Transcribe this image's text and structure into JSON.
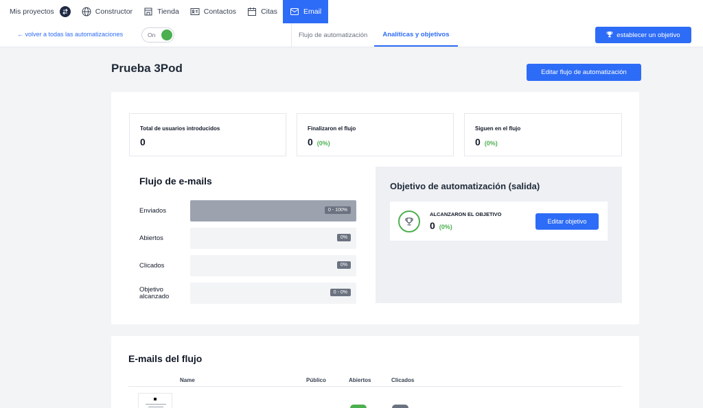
{
  "topnav": {
    "projects": "Mis proyectos",
    "items": [
      {
        "label": "Constructor",
        "icon": "globe-icon"
      },
      {
        "label": "Tienda",
        "icon": "store-icon"
      },
      {
        "label": "Contactos",
        "icon": "contact-card-icon"
      },
      {
        "label": "Citas",
        "icon": "calendar-icon"
      },
      {
        "label": "Email",
        "icon": "mail-icon",
        "active": true
      }
    ]
  },
  "subbar": {
    "back_link": "← volver a todas las automatizaciones",
    "toggle_label": "On",
    "toggle_on": true,
    "tabs": [
      "Flujo de automatización",
      "Analíticas y objetivos"
    ],
    "active_tab": 1,
    "goal_button": "establecer un objetivo"
  },
  "header": {
    "title": "Prueba 3Pod",
    "subtitle": "",
    "edit_flow_button": "Editar flujo de automatización"
  },
  "stats": [
    {
      "label": "Total de usuarios introducidos",
      "value": "0",
      "pct": ""
    },
    {
      "label": "Finalizaron el flujo",
      "value": "0",
      "pct": "(0%)"
    },
    {
      "label": "Siguen en el flujo",
      "value": "0",
      "pct": "(0%)"
    }
  ],
  "email_flow": {
    "title": "Flujo de e-mails",
    "rows": [
      {
        "label": "Enviados",
        "badge": "0 - 100%",
        "fill": 1.0
      },
      {
        "label": "Abiertos",
        "badge": "0%",
        "fill": 0
      },
      {
        "label": "Clicados",
        "badge": "0%",
        "fill": 0
      },
      {
        "label": "Objetivo alcanzado",
        "badge": "0 - 0%",
        "fill": 0
      }
    ]
  },
  "goal": {
    "title": "Objetivo de automatización (salida)",
    "reached_label": "ALCANZARON EL OBJETIVO",
    "reached_value": "0",
    "reached_pct": "(0%)",
    "edit_button": "Editar objetivo"
  },
  "emails": {
    "title": "E-mails del flujo",
    "columns": [
      "Name",
      "Público",
      "Abiertos",
      "Clicados"
    ]
  },
  "colors": {
    "accent": "#2d6cf6",
    "success": "#4caf50",
    "muted_badge": "#6b7280"
  }
}
